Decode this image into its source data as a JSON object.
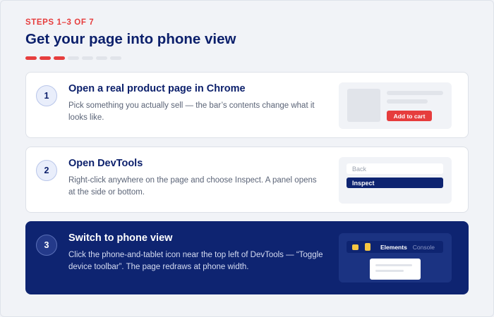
{
  "header": {
    "kicker": "STEPS 1–3 OF 7",
    "title": "Get your page into phone view",
    "progress": {
      "completed": 3,
      "total": 7
    }
  },
  "colors": {
    "accent_red": "#e63d3d",
    "navy": "#0b1f6b",
    "active_card": "#0e2471",
    "background": "#f1f3f7"
  },
  "steps": [
    {
      "number": "1",
      "title": "Open a real product page in Chrome",
      "description": "Pick something you actually sell — the bar’s contents change what it looks like.",
      "illustration": {
        "button_label": "Add to cart"
      }
    },
    {
      "number": "2",
      "title": "Open DevTools",
      "description": "Right-click anywhere on the page and choose Inspect. A panel opens at the side or bottom.",
      "illustration": {
        "menu_items": [
          "Back",
          "Inspect"
        ]
      }
    },
    {
      "number": "3",
      "title": "Switch to phone view",
      "description": "Click the phone-and-tablet icon near the top left of DevTools — “Toggle device toolbar”. The page redraws at phone width.",
      "active": true,
      "illustration": {
        "tabs": [
          "Elements",
          "Console"
        ],
        "icon": "device-toolbar-icon"
      }
    }
  ]
}
